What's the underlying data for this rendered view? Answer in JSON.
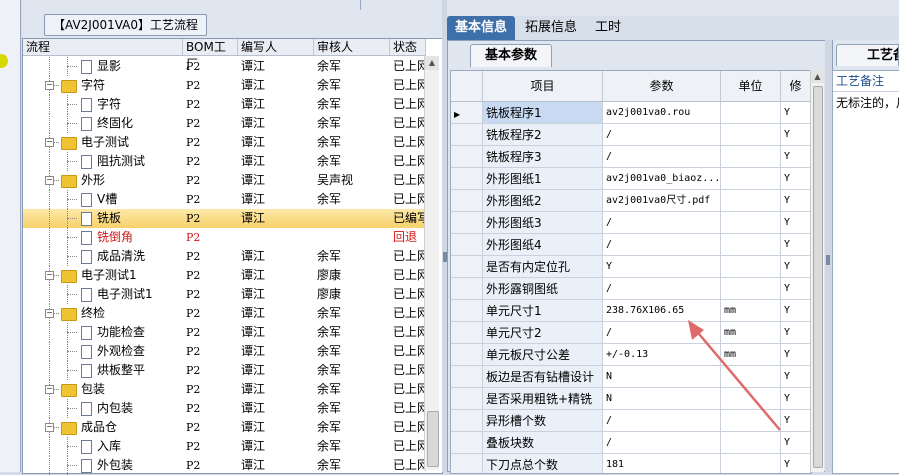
{
  "tree": {
    "title": "【AV2J001VA0】工艺流程",
    "columns": [
      "流程",
      "BOM工厂",
      "编写人",
      "审核人",
      "状态"
    ],
    "rows": [
      {
        "depth": 2,
        "kind": "doc",
        "label": "显影",
        "bom": "P2",
        "writer": "谭江",
        "reviewer": "余军",
        "status": "已上网",
        "style": "normal"
      },
      {
        "depth": 1,
        "kind": "folder",
        "label": "字符",
        "bom": "P2",
        "writer": "谭江",
        "reviewer": "余军",
        "status": "已上网",
        "style": "normal"
      },
      {
        "depth": 2,
        "kind": "doc",
        "label": "字符",
        "bom": "P2",
        "writer": "谭江",
        "reviewer": "余军",
        "status": "已上网",
        "style": "normal"
      },
      {
        "depth": 2,
        "kind": "doc",
        "label": "终固化",
        "bom": "P2",
        "writer": "谭江",
        "reviewer": "余军",
        "status": "已上网",
        "style": "normal"
      },
      {
        "depth": 1,
        "kind": "folder",
        "label": "电子测试",
        "bom": "P2",
        "writer": "谭江",
        "reviewer": "余军",
        "status": "已上网",
        "style": "normal"
      },
      {
        "depth": 2,
        "kind": "doc",
        "label": "阻抗测试",
        "bom": "P2",
        "writer": "谭江",
        "reviewer": "余军",
        "status": "已上网",
        "style": "normal"
      },
      {
        "depth": 1,
        "kind": "folder",
        "label": "外形",
        "bom": "P2",
        "writer": "谭江",
        "reviewer": "吴声视",
        "status": "已上网",
        "style": "normal"
      },
      {
        "depth": 2,
        "kind": "doc",
        "label": "V槽",
        "bom": "P2",
        "writer": "谭江",
        "reviewer": "余军",
        "status": "已上网",
        "style": "normal"
      },
      {
        "depth": 2,
        "kind": "doc",
        "label": "铣板",
        "bom": "P2",
        "writer": "谭江",
        "reviewer": "",
        "status": "已编写",
        "style": "selected"
      },
      {
        "depth": 2,
        "kind": "doc",
        "label": "铣倒角",
        "bom": "P2",
        "writer": "",
        "reviewer": "",
        "status": "回退",
        "style": "red"
      },
      {
        "depth": 2,
        "kind": "doc",
        "label": "成品清洗",
        "bom": "P2",
        "writer": "谭江",
        "reviewer": "余军",
        "status": "已上网",
        "style": "normal"
      },
      {
        "depth": 1,
        "kind": "folder",
        "label": "电子测试1",
        "bom": "P2",
        "writer": "谭江",
        "reviewer": "廖康",
        "status": "已上网",
        "style": "normal"
      },
      {
        "depth": 2,
        "kind": "doc",
        "label": "电子测试1",
        "bom": "P2",
        "writer": "谭江",
        "reviewer": "廖康",
        "status": "已上网",
        "style": "normal"
      },
      {
        "depth": 1,
        "kind": "folder",
        "label": "终检",
        "bom": "P2",
        "writer": "谭江",
        "reviewer": "余军",
        "status": "已上网",
        "style": "normal"
      },
      {
        "depth": 2,
        "kind": "doc",
        "label": "功能检查",
        "bom": "P2",
        "writer": "谭江",
        "reviewer": "余军",
        "status": "已上网",
        "style": "normal"
      },
      {
        "depth": 2,
        "kind": "doc",
        "label": "外观检查",
        "bom": "P2",
        "writer": "谭江",
        "reviewer": "余军",
        "status": "已上网",
        "style": "normal"
      },
      {
        "depth": 2,
        "kind": "doc",
        "label": "烘板整平",
        "bom": "P2",
        "writer": "谭江",
        "reviewer": "余军",
        "status": "已上网",
        "style": "normal"
      },
      {
        "depth": 1,
        "kind": "folder",
        "label": "包装",
        "bom": "P2",
        "writer": "谭江",
        "reviewer": "余军",
        "status": "已上网",
        "style": "normal"
      },
      {
        "depth": 2,
        "kind": "doc",
        "label": "内包装",
        "bom": "P2",
        "writer": "谭江",
        "reviewer": "余军",
        "status": "已上网",
        "style": "normal"
      },
      {
        "depth": 1,
        "kind": "folder",
        "label": "成品仓",
        "bom": "P2",
        "writer": "谭江",
        "reviewer": "余军",
        "status": "已上网",
        "style": "normal"
      },
      {
        "depth": 2,
        "kind": "doc",
        "label": "入库",
        "bom": "P2",
        "writer": "谭江",
        "reviewer": "余军",
        "status": "已上网",
        "style": "normal"
      },
      {
        "depth": 2,
        "kind": "doc",
        "label": "外包装",
        "bom": "P2",
        "writer": "谭江",
        "reviewer": "余军",
        "status": "已上网",
        "style": "normal"
      }
    ]
  },
  "tabs": [
    "基本信息",
    "拓展信息",
    "工时"
  ],
  "subtab": "基本参数",
  "grid": {
    "columns": [
      "项目",
      "参数",
      "单位",
      "修"
    ],
    "rows": [
      {
        "name": "铣板程序1",
        "value": "av2j001va0.rou",
        "unit": "",
        "edit": "Y"
      },
      {
        "name": "铣板程序2",
        "value": "/",
        "unit": "",
        "edit": "Y"
      },
      {
        "name": "铣板程序3",
        "value": "/",
        "unit": "",
        "edit": "Y"
      },
      {
        "name": "外形图纸1",
        "value": "av2j001va0_biaoz...",
        "unit": "",
        "edit": "Y"
      },
      {
        "name": "外形图纸2",
        "value": "av2j001va0尺寸.pdf",
        "unit": "",
        "edit": "Y"
      },
      {
        "name": "外形图纸3",
        "value": "/",
        "unit": "",
        "edit": "Y"
      },
      {
        "name": "外形图纸4",
        "value": "/",
        "unit": "",
        "edit": "Y"
      },
      {
        "name": "是否有内定位孔",
        "value": "Y",
        "unit": "",
        "edit": "Y"
      },
      {
        "name": "外形露铜图纸",
        "value": "/",
        "unit": "",
        "edit": "Y"
      },
      {
        "name": "单元尺寸1",
        "value": "238.76X106.65",
        "unit": "mm",
        "edit": "Y"
      },
      {
        "name": "单元尺寸2",
        "value": "/",
        "unit": "mm",
        "edit": "Y"
      },
      {
        "name": "单元板尺寸公差",
        "value": "+/-0.13",
        "unit": "mm",
        "edit": "Y"
      },
      {
        "name": "板边是否有钻槽设计",
        "value": "N",
        "unit": "",
        "edit": "Y"
      },
      {
        "name": "是否采用粗铣+精铣",
        "value": "N",
        "unit": "",
        "edit": "Y"
      },
      {
        "name": "异形槽个数",
        "value": "/",
        "unit": "",
        "edit": "Y"
      },
      {
        "name": "叠板块数",
        "value": "/",
        "unit": "",
        "edit": "Y"
      },
      {
        "name": "下刀点总个数",
        "value": "181",
        "unit": "",
        "edit": "Y"
      }
    ]
  },
  "remark": {
    "tab": "工艺备",
    "header": "工艺备注",
    "text": "无标注的，尺"
  },
  "colors": {
    "active_tab": "#3d6fa8",
    "selected_row": "#f7d16b",
    "red_text": "#d01818",
    "annotation_arrow": "#e06a6a"
  }
}
